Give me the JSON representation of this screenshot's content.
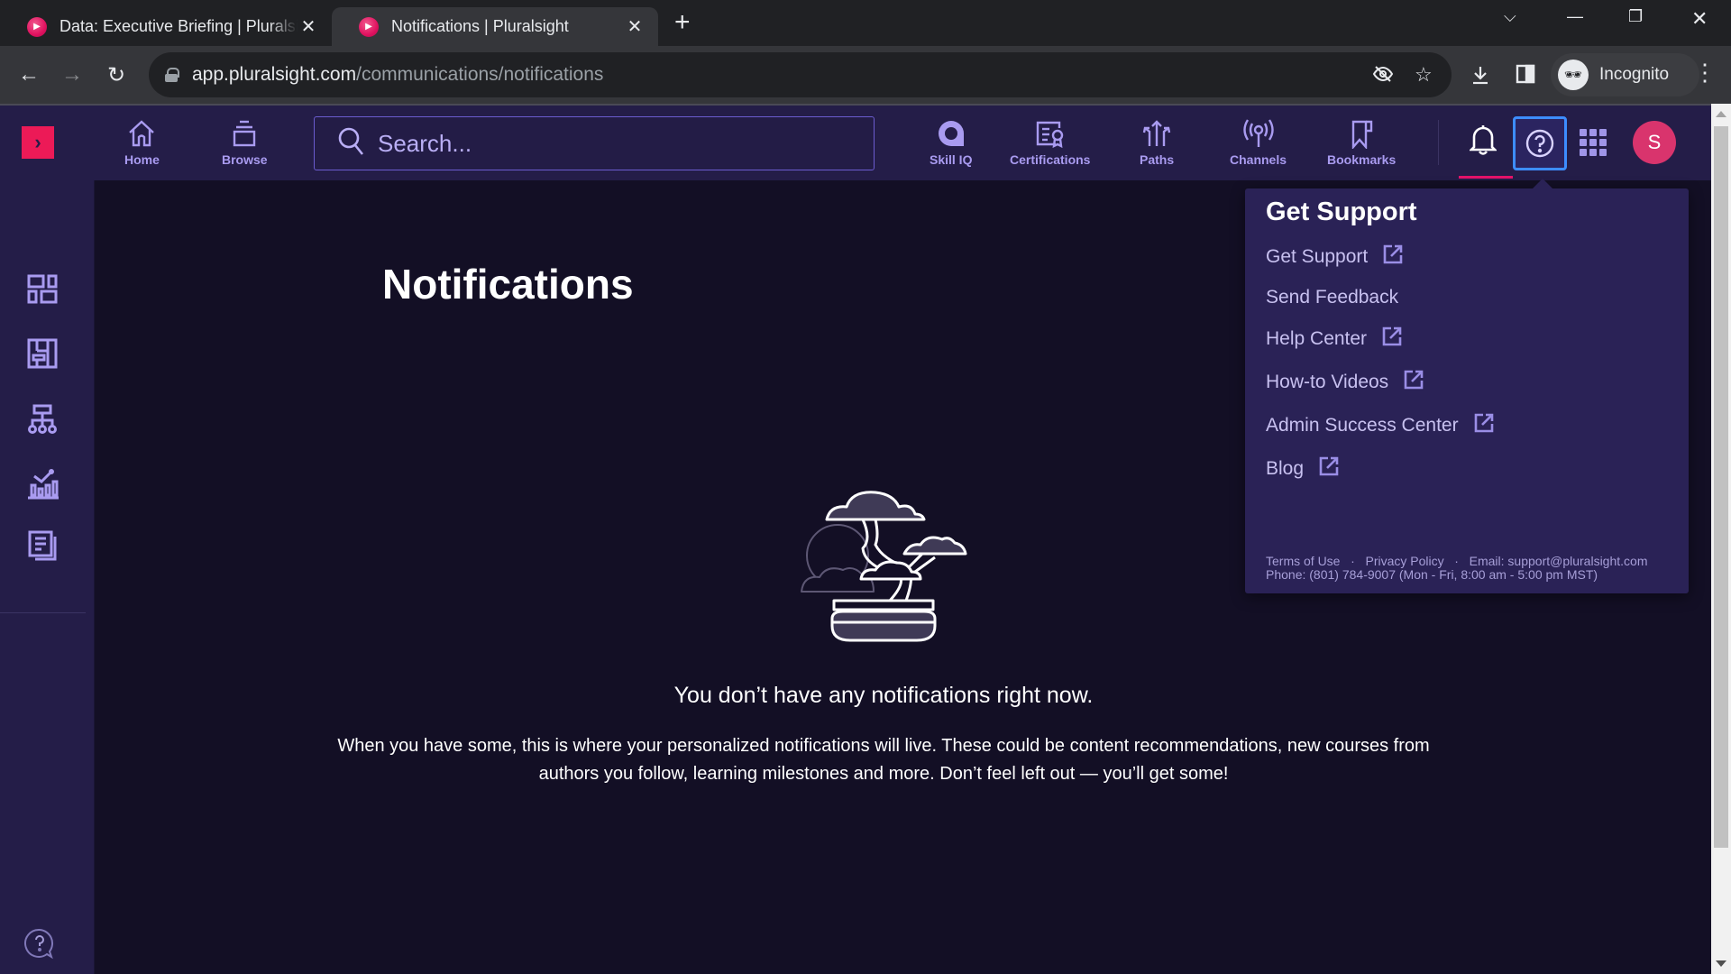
{
  "browser": {
    "tabs": [
      {
        "title": "Data: Executive Briefing | Pluralsight",
        "active": false
      },
      {
        "title": "Notifications | Pluralsight",
        "active": true
      }
    ],
    "new_tab_label": "+",
    "url_domain": "app.pluralsight.com",
    "url_path": "/communications/notifications",
    "profile_label": "Incognito"
  },
  "header": {
    "search_placeholder": "Search...",
    "nav_left": [
      {
        "label": "Home",
        "icon": "home-icon"
      },
      {
        "label": "Browse",
        "icon": "browse-icon"
      }
    ],
    "nav_right": [
      {
        "label": "Skill IQ",
        "icon": "skill-iq-icon"
      },
      {
        "label": "Certifications",
        "icon": "certifications-icon"
      },
      {
        "label": "Paths",
        "icon": "paths-icon"
      },
      {
        "label": "Channels",
        "icon": "channels-icon"
      },
      {
        "label": "Bookmarks",
        "icon": "bookmarks-icon"
      }
    ],
    "avatar_initial": "S",
    "colors": {
      "brand": "#ec1a57",
      "accent": "#a99bf0",
      "avatar": "#d9346d",
      "focus": "#3d8dff"
    }
  },
  "sidebar": {
    "items": [
      {
        "icon": "dashboard-icon"
      },
      {
        "icon": "plans-icon"
      },
      {
        "icon": "org-chart-icon"
      },
      {
        "icon": "analytics-icon"
      },
      {
        "icon": "reports-icon"
      }
    ],
    "help_icon": "help-chat-icon"
  },
  "main": {
    "title": "Notifications",
    "empty_title": "You don’t have any notifications right now.",
    "empty_body": "When you have some, this is where your personalized notifications will live. These could be content recommendations, new courses from authors you follow, learning milestones and more. Don’t feel left out — you’ll get some!"
  },
  "support_menu": {
    "heading": "Get Support",
    "links": [
      {
        "label": "Get Support",
        "external": true
      },
      {
        "label": "Send Feedback",
        "external": false
      },
      {
        "label": "Help Center",
        "external": true
      },
      {
        "label": "How-to Videos",
        "external": true
      },
      {
        "label": "Admin Success Center",
        "external": true
      },
      {
        "label": "Blog",
        "external": true
      }
    ],
    "footer": {
      "terms": "Terms of Use",
      "privacy": "Privacy Policy",
      "email": "Email: support@pluralsight.com",
      "phone": "Phone: (801) 784-9007 (Mon - Fri, 8:00 am - 5:00 pm MST)"
    }
  }
}
